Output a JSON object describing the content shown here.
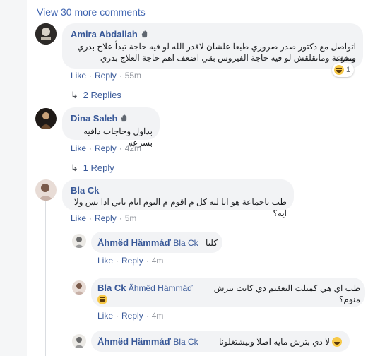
{
  "view_more": "View 30 more comments",
  "comments": [
    {
      "name": "Amira Abdallah",
      "text_line1": "اتواصل مع دكتور صدر ضروري طبعا علشان لاقدر الله لو فيه حاجة تبدأ علاج بدري وتخف",
      "text_line2": "بسرعة وماتقلقش لو فيه حاجة الفيروس بقي اضعف اهم حاجة العلاج بدري",
      "like": "Like",
      "reply": "Reply",
      "time": "55m",
      "reaction_count": "1",
      "replies": "2 Replies"
    },
    {
      "name": "Dina Saleh",
      "text": "بداول وحاجات دافيه بسرعه",
      "like": "Like",
      "reply": "Reply",
      "time": "42m",
      "replies": "1 Reply"
    },
    {
      "name": "Bla Ck",
      "text": "طب باجماعة هو انا ليه كل م اقوم م النوم انام تاني اذا بس ولا ايه؟",
      "like": "Like",
      "reply": "Reply",
      "time": "5m"
    }
  ],
  "nested": [
    {
      "name": "Ähmëd Hämmáď",
      "tag": "Bla Ck",
      "text": "كلتا",
      "like": "Like",
      "reply": "Reply",
      "time": "4m"
    },
    {
      "name": "Bla Ck",
      "tag": "Ähmëd Hämmáď",
      "text": "طب اي هي كميلت التعقيم دي كانت بترش منوم؟",
      "like": "Like",
      "reply": "Reply",
      "time": "4m"
    },
    {
      "name": "Ähmëd Hämmáď",
      "tag": "Bla Ck",
      "text": "لا دي بترش مايه اصلا وبيشتغلونا"
    }
  ],
  "colors": {
    "link": "#385898",
    "bubble": "#f2f3f5",
    "muted": "#90949c"
  }
}
